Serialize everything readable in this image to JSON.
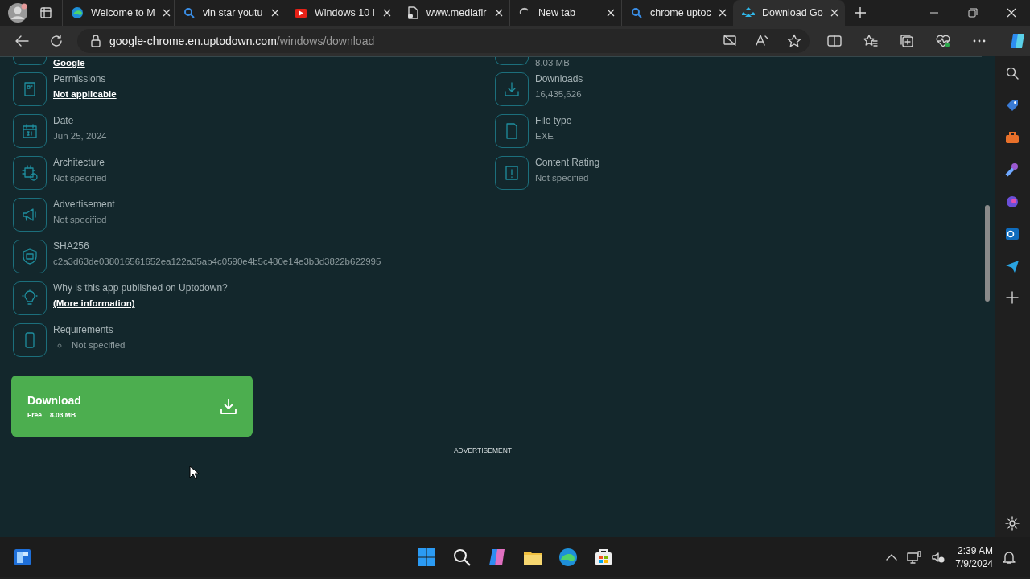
{
  "browser": {
    "tabs": [
      {
        "title": "Welcome to M",
        "selected": false
      },
      {
        "title": "vin star youtu",
        "selected": false
      },
      {
        "title": "Windows 10 I",
        "selected": false
      },
      {
        "title": "www.mediafir",
        "selected": false
      },
      {
        "title": "New tab",
        "selected": false
      },
      {
        "title": "chrome uptoc",
        "selected": false
      },
      {
        "title": "Download Go",
        "selected": true
      }
    ],
    "address": {
      "host": "google-chrome.en.uptodown.com",
      "path": "/windows/download"
    }
  },
  "page": {
    "left_details": [
      {
        "value": "Google",
        "kind": "link"
      },
      {
        "label": "Permissions",
        "value": "Not applicable",
        "kind": "link"
      },
      {
        "label": "Date",
        "value": "Jun 25, 2024",
        "kind": "plain"
      },
      {
        "label": "Architecture",
        "value": "Not specified",
        "kind": "plain"
      },
      {
        "label": "Advertisement",
        "value": "Not specified",
        "kind": "plain"
      },
      {
        "label": "SHA256",
        "value": "c2a3d63de038016561652ea122a35ab4c0590e4b5c480e14e3b3d3822b622995",
        "kind": "plain"
      },
      {
        "label": "Why is this app published on Uptodown?",
        "value": "(More information)",
        "kind": "link"
      },
      {
        "label": "Requirements",
        "value": "Not specified",
        "kind": "bullet"
      }
    ],
    "right_details": [
      {
        "value": "8.03 MB",
        "kind": "plain"
      },
      {
        "label": "Downloads",
        "value": "16,435,626",
        "kind": "plain"
      },
      {
        "label": "File type",
        "value": "EXE",
        "kind": "plain"
      },
      {
        "label": "Content Rating",
        "value": "Not specified",
        "kind": "plain"
      }
    ],
    "download": {
      "title": "Download",
      "price": "Free",
      "size": "8.03 MB"
    },
    "ad_label": "ADVERTISEMENT"
  },
  "taskbar": {
    "time": "2:39 AM",
    "date": "7/9/2024"
  }
}
